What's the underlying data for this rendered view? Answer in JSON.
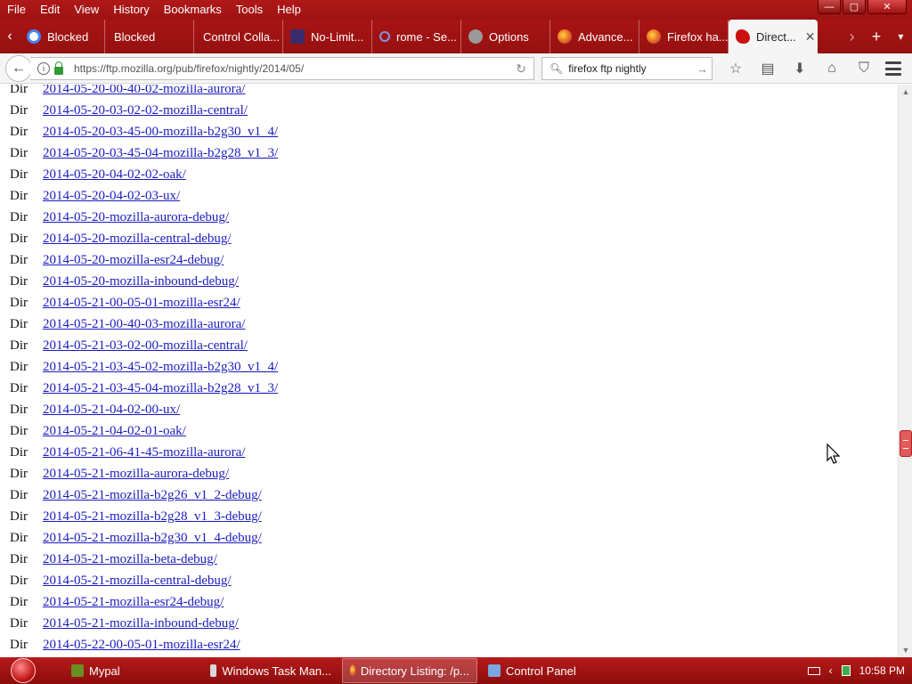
{
  "menu": [
    "File",
    "Edit",
    "View",
    "History",
    "Bookmarks",
    "Tools",
    "Help"
  ],
  "window_controls": {
    "minimize": "—",
    "maximize": "▢",
    "close": "✕"
  },
  "tabs": [
    {
      "label": "Blocked",
      "icon_color": "#4285f4",
      "icon": "google-icon"
    },
    {
      "label": "Blocked",
      "icon_color": "",
      "icon": ""
    },
    {
      "label": "Control Colla...",
      "icon_color": "",
      "icon": ""
    },
    {
      "label": "No-Limit...",
      "icon_color": "#3b2a6a",
      "icon": "extension-icon"
    },
    {
      "label": "rome - Se...",
      "icon_color": "#5b6bd6",
      "icon": "search-icon"
    },
    {
      "label": "Options",
      "icon_color": "#888888",
      "icon": "gear-icon"
    },
    {
      "label": "Advance...",
      "icon_color": "#e8661c",
      "icon": "firefox-icon"
    },
    {
      "label": "Firefox ha...",
      "icon_color": "#e8661c",
      "icon": "firefox-icon"
    },
    {
      "label": "Direct...",
      "icon_color": "#cc1010",
      "icon": "mozilla-dino-icon"
    }
  ],
  "tab_close": "✕",
  "tabstrip_right": {
    "scroll": "›",
    "new_tab": "+",
    "list": "▾"
  },
  "nav": {
    "back": "←",
    "url": "https://ftp.mozilla.org/pub/firefox/nightly/2014/05/",
    "reload": "↻",
    "search_value": "firefox ftp nightly",
    "search_go": "→"
  },
  "listing": {
    "type_label": "Dir",
    "entries": [
      "2014-05-20-00-40-02-mozilla-aurora/",
      "2014-05-20-03-02-02-mozilla-central/",
      "2014-05-20-03-45-00-mozilla-b2g30_v1_4/",
      "2014-05-20-03-45-04-mozilla-b2g28_v1_3/",
      "2014-05-20-04-02-02-oak/",
      "2014-05-20-04-02-03-ux/",
      "2014-05-20-mozilla-aurora-debug/",
      "2014-05-20-mozilla-central-debug/",
      "2014-05-20-mozilla-esr24-debug/",
      "2014-05-20-mozilla-inbound-debug/",
      "2014-05-21-00-05-01-mozilla-esr24/",
      "2014-05-21-00-40-03-mozilla-aurora/",
      "2014-05-21-03-02-00-mozilla-central/",
      "2014-05-21-03-45-02-mozilla-b2g30_v1_4/",
      "2014-05-21-03-45-04-mozilla-b2g28_v1_3/",
      "2014-05-21-04-02-00-ux/",
      "2014-05-21-04-02-01-oak/",
      "2014-05-21-06-41-45-mozilla-aurora/",
      "2014-05-21-mozilla-aurora-debug/",
      "2014-05-21-mozilla-b2g26_v1_2-debug/",
      "2014-05-21-mozilla-b2g28_v1_3-debug/",
      "2014-05-21-mozilla-b2g30_v1_4-debug/",
      "2014-05-21-mozilla-beta-debug/",
      "2014-05-21-mozilla-central-debug/",
      "2014-05-21-mozilla-esr24-debug/",
      "2014-05-21-mozilla-inbound-debug/",
      "2014-05-22-00-05-01-mozilla-esr24/"
    ]
  },
  "scrollbar": {
    "up": "▲",
    "down": "▼",
    "position_fraction": 0.6
  },
  "taskbar": {
    "tasks": [
      {
        "label": "Mypal",
        "icon_color": "#6b8e23",
        "active": false
      },
      {
        "label": "Windows Task Man...",
        "icon_color": "#d8d8d8",
        "active": false
      },
      {
        "label": "Directory Listing: /p...",
        "icon_color": "#e8661c",
        "active": true
      },
      {
        "label": "Control Panel",
        "icon_color": "#7aa7e0",
        "active": false
      }
    ],
    "tray_arrow": "‹",
    "clock": "10:58 PM"
  },
  "colors": {
    "theme_red": "#a81414",
    "link": "#1b1bbd"
  }
}
